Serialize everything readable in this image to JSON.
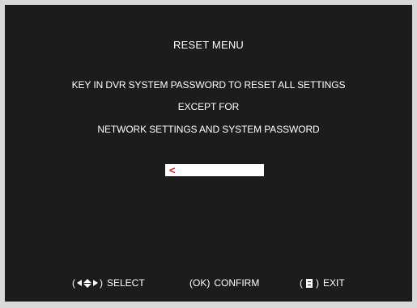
{
  "menu": {
    "title": "RESET MENU",
    "message_line1": "KEY IN DVR SYSTEM PASSWORD TO RESET ALL  SETTINGS",
    "message_line2": "EXCEPT FOR",
    "message_line3": "NETWORK SETTINGS AND SYSTEM PASSWORD"
  },
  "password_field": {
    "cursor_glyph": "<",
    "value": ""
  },
  "footer": {
    "select": {
      "open": "(",
      "close": ")",
      "label": "SELECT",
      "icon": "four-direction-arrows-icon"
    },
    "confirm": {
      "key": "(OK)",
      "label": "CONFIRM"
    },
    "exit": {
      "open": "(",
      "close": ")",
      "label": "EXIT",
      "icon": "menu-key-icon"
    }
  },
  "colors": {
    "screen_background": "#1c1c1c",
    "bezel": "#d9d9d9",
    "text": "#ffffff",
    "cursor": "#d2202a"
  }
}
